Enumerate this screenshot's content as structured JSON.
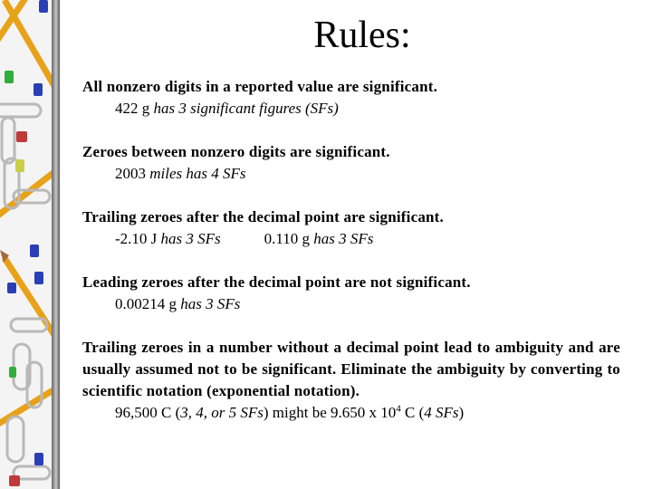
{
  "title": "Rules:",
  "rules": [
    {
      "statement": "All nonzero digits in a reported value are significant.",
      "example_value": "422 g",
      "example_note": "has 3 significant figures (SFs)"
    },
    {
      "statement": "Zeroes between nonzero digits are significant.",
      "example_value": "2003",
      "example_note": "miles has 4 SFs"
    },
    {
      "statement": "Trailing zeroes after the decimal point are significant.",
      "example_value": "-2.10 J",
      "example_note": "has 3 SFs",
      "example2_value": "0.110 g",
      "example2_note": "has 3 SFs"
    },
    {
      "statement": "Leading zeroes after the decimal point are not significant.",
      "example_value": "0.00214 g",
      "example_note": "has 3 SFs"
    },
    {
      "statement": "Trailing zeroes in a number without a decimal point lead to ambiguity and are usually assumed not to be significant. Eliminate the ambiguity by converting to scientific notation (exponential notation).",
      "example_value": "96,500 C (",
      "example_note": "3, 4, or 5 SFs",
      "example_mid": ") might be 9.650 x 10",
      "example_exp": "4",
      "example_tail": " C (",
      "example_note2": "4 SFs",
      "example_close": ")"
    }
  ],
  "sidebar": {
    "decoration": [
      "pencil-icon",
      "pushpin-icon",
      "paperclip-icon"
    ]
  }
}
